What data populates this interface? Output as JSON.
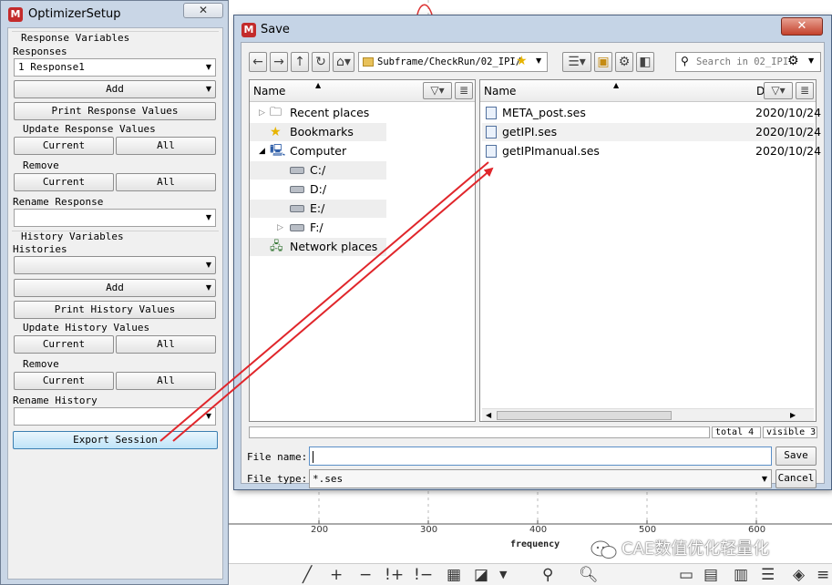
{
  "background_plot": {
    "ticks": [
      "200",
      "300",
      "400",
      "500",
      "600"
    ],
    "axis_label": "frequency",
    "watermark": "CAE数值优化轻量化"
  },
  "optimizer": {
    "title": "OptimizerSetup",
    "response_section": "Response Variables",
    "responses_label": "Responses",
    "responses_selected": "1 Response1",
    "add_label": "Add",
    "print_response_label": "Print Response Values",
    "update_response_label": "Update Response Values",
    "current_label": "Current",
    "all_label": "All",
    "remove_label": "Remove",
    "rename_response_label": "Rename Response",
    "rename_response_value": "",
    "history_section": "History Variables",
    "histories_label": "Histories",
    "histories_selected": "",
    "print_history_label": "Print History Values",
    "update_history_label": "Update History Values",
    "rename_history_label": "Rename History",
    "rename_history_value": "",
    "export_label": "Export Session"
  },
  "save_dialog": {
    "title": "Save",
    "path": "Subframe/CheckRun/02_IPI/",
    "search_placeholder": "Search in 02_IPI",
    "left_header": "Name",
    "right_header_name": "Name",
    "right_header_date": "D",
    "places": [
      "Recent places",
      "Bookmarks",
      "Computer",
      "C:/",
      "D:/",
      "E:/",
      "F:/",
      "Network places"
    ],
    "files": [
      {
        "name": "META_post.ses",
        "date": "2020/10/24"
      },
      {
        "name": "getIPI.ses",
        "date": "2020/10/24"
      },
      {
        "name": "getIPImanual.ses",
        "date": "2020/10/24"
      }
    ],
    "status_total": "total 4",
    "status_visible": "visible 3",
    "file_name_label": "File name:",
    "file_name_value": "",
    "file_type_label": "File type:",
    "file_type_value": "*.ses",
    "save_button": "Save",
    "cancel_button": "Cancel"
  },
  "colors": {
    "window_frame": "#c9d6e6",
    "panel_bg": "#f0f0f0",
    "close_red": "#c4412c",
    "annotation_arrow": "#e0262b",
    "export_highlight": "#bfe4f8"
  }
}
